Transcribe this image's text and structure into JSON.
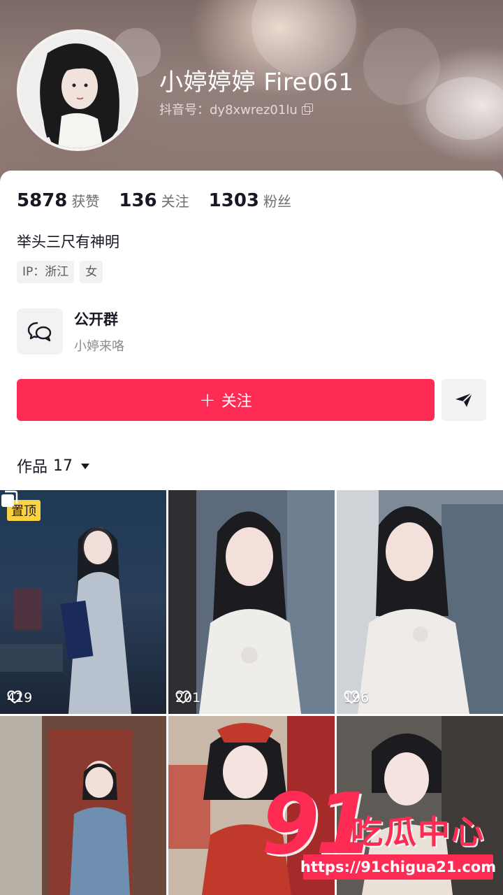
{
  "profile": {
    "nickname": "小婷婷婷 Fire061",
    "handle": "抖音号：dy8xwrez01lu",
    "bio": "举头三尺有神明",
    "tags": [
      "IP：浙江",
      "女"
    ]
  },
  "stats": [
    {
      "value": "5878",
      "label": "获赞"
    },
    {
      "value": "136",
      "label": "关注"
    },
    {
      "value": "1303",
      "label": "粉丝"
    }
  ],
  "group": {
    "title": "公开群",
    "subtitle": "小婷来咯"
  },
  "actions": {
    "follow_label": "关注",
    "follow_plus": "+"
  },
  "works": {
    "title": "作品",
    "count": "17"
  },
  "videos": [
    {
      "likes": "419",
      "pinned_label": "置顶",
      "multi_image": true
    },
    {
      "likes": "201"
    },
    {
      "likes": "196"
    },
    {
      "likes": ""
    },
    {
      "likes": ""
    },
    {
      "likes": ""
    }
  ],
  "watermark": {
    "number": "91",
    "text": "吃瓜中心",
    "url": "https://91chigua21.com"
  },
  "colors": {
    "accent": "#fe2c55",
    "pin_badge": "#fbd342"
  }
}
